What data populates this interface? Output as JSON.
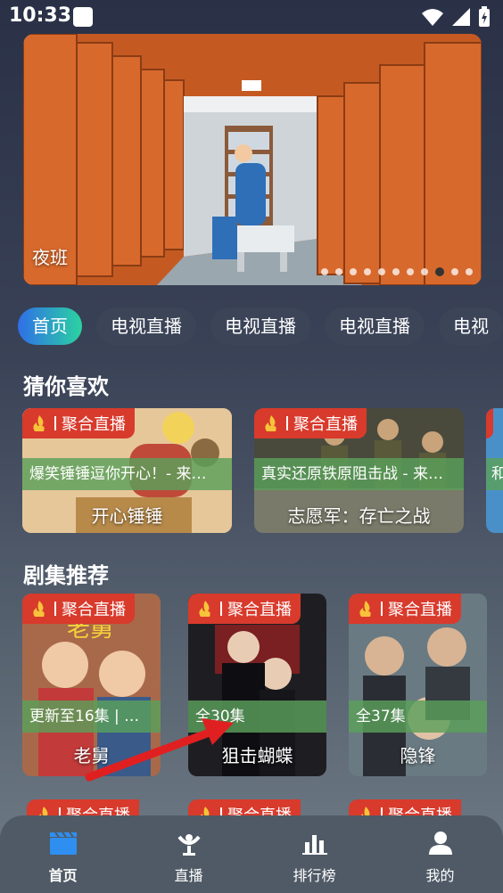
{
  "status": {
    "time": "10:33"
  },
  "banner": {
    "title": "夜班",
    "dot_count": 11,
    "active_dot": 8
  },
  "tabs": [
    {
      "label": "首页",
      "active": true
    },
    {
      "label": "电视直播"
    },
    {
      "label": "电视直播"
    },
    {
      "label": "电视直播"
    },
    {
      "label": "电视"
    }
  ],
  "guess": {
    "title": "猜你喜欢",
    "items": [
      {
        "badge": "聚合直播",
        "desc": "爆笑锤锤逗你开心！- 来…",
        "name": "开心锤锤"
      },
      {
        "badge": "聚合直播",
        "desc": "真实还原铁原阻击战 - 来…",
        "name": "志愿军：存亡之战"
      },
      {
        "badge": "",
        "desc": "和",
        "name": ""
      }
    ]
  },
  "series": {
    "title": "剧集推荐",
    "items": [
      {
        "badge": "聚合直播",
        "desc": "更新至16集 | 老…",
        "name": "老舅"
      },
      {
        "badge": "聚合直播",
        "desc": "全30集",
        "name": "狙击蝴蝶"
      },
      {
        "badge": "聚合直播",
        "desc": "全37集",
        "name": "隐锋"
      }
    ],
    "next_badges": [
      "聚合直播",
      "聚合直播",
      "聚合直播"
    ]
  },
  "nav": [
    {
      "label": "首页",
      "icon": "clapperboard-icon",
      "active": true
    },
    {
      "label": "直播",
      "icon": "broadcast-icon"
    },
    {
      "label": "排行榜",
      "icon": "bar-chart-icon"
    },
    {
      "label": "我的",
      "icon": "user-icon"
    }
  ],
  "colors": {
    "accent_start": "#2f6fe8",
    "accent_end": "#2bd3a0",
    "badge": "#d83a2c",
    "active_nav": "#2f8ff0"
  }
}
